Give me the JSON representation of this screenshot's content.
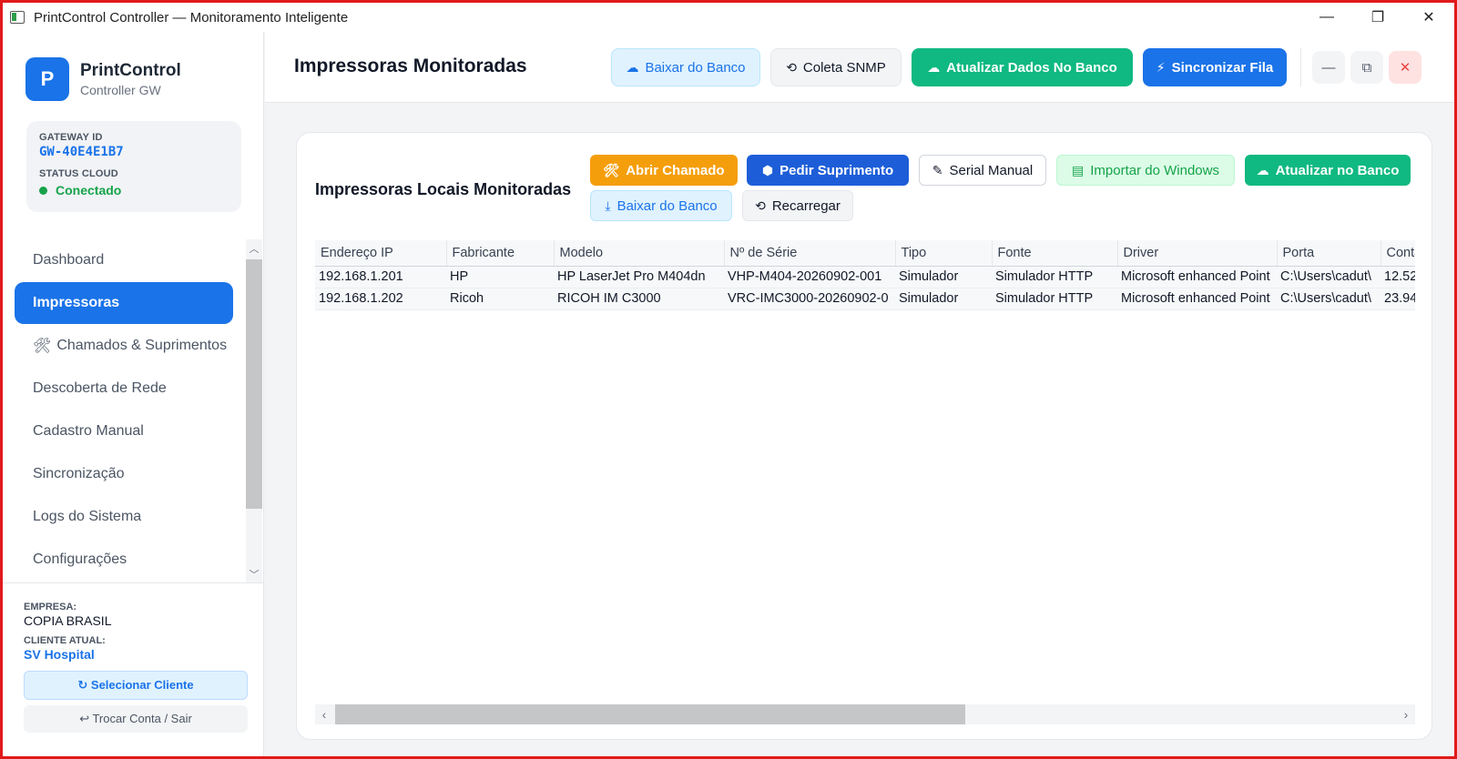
{
  "window": {
    "title": "PrintControl Controller — Monitoramento Inteligente",
    "controls": [
      "—",
      "❐",
      "✕"
    ]
  },
  "brand": {
    "logo_letter": "P",
    "name": "PrintControl",
    "subtitle": "Controller GW"
  },
  "gateway": {
    "id_label": "GATEWAY ID",
    "id_value": "GW-40E4E1B7",
    "status_label": "STATUS CLOUD",
    "status_value": "Conectado"
  },
  "sidebar": {
    "items": [
      {
        "label": "Dashboard"
      },
      {
        "label": "Impressoras"
      },
      {
        "label": "Chamados & Suprimentos"
      },
      {
        "label": "Descoberta de Rede"
      },
      {
        "label": "Cadastro Manual"
      },
      {
        "label": "Sincronização"
      },
      {
        "label": "Logs do Sistema"
      },
      {
        "label": "Configurações"
      }
    ],
    "active_index": 1
  },
  "footer": {
    "company_label": "EMPRESA:",
    "company_value": "COPIA BRASIL",
    "client_label": "CLIENTE ATUAL:",
    "client_value": "SV Hospital",
    "select_client": "↻ Selecionar Cliente",
    "switch_account": "↩ Trocar Conta / Sair"
  },
  "header": {
    "title": "Impressoras Monitoradas",
    "buttons": {
      "baixar": "Baixar do Banco",
      "snmp": "Coleta SNMP",
      "atualizar": "Atualizar Dados No Banco",
      "sincronizar": "Sincronizar Fila"
    }
  },
  "card": {
    "title": "Impressoras Locais Monitoradas",
    "buttons": {
      "chamado": "Abrir Chamado",
      "suprimento": "Pedir Suprimento",
      "serial": "Serial Manual",
      "importar": "Importar do Windows",
      "atualizar": "Atualizar no Banco",
      "baixar": "Baixar do Banco",
      "recarregar": "Recarregar"
    }
  },
  "table": {
    "columns": [
      "Endereço IP",
      "Fabricante",
      "Modelo",
      "Nº de Série",
      "Tipo",
      "Fonte",
      "Driver",
      "Porta",
      "Conta"
    ],
    "rows": [
      [
        "192.168.1.201",
        "HP",
        "HP LaserJet Pro M404dn",
        "VHP-M404-20260902-001",
        "Simulador",
        "Simulador HTTP",
        "Microsoft enhanced Point",
        "C:\\Users\\cadut\\",
        "12.52"
      ],
      [
        "192.168.1.202",
        "Ricoh",
        "RICOH IM C3000",
        "VRC-IMC3000-20260902-0",
        "Simulador",
        "Simulador HTTP",
        "Microsoft enhanced Point",
        "C:\\Users\\cadut\\",
        "23.94"
      ]
    ]
  },
  "colors": {
    "primary": "#1a73e8",
    "success": "#10b981",
    "warning": "#f59e0b",
    "danger": "#ef4444",
    "frame_border": "#e01a1a"
  }
}
